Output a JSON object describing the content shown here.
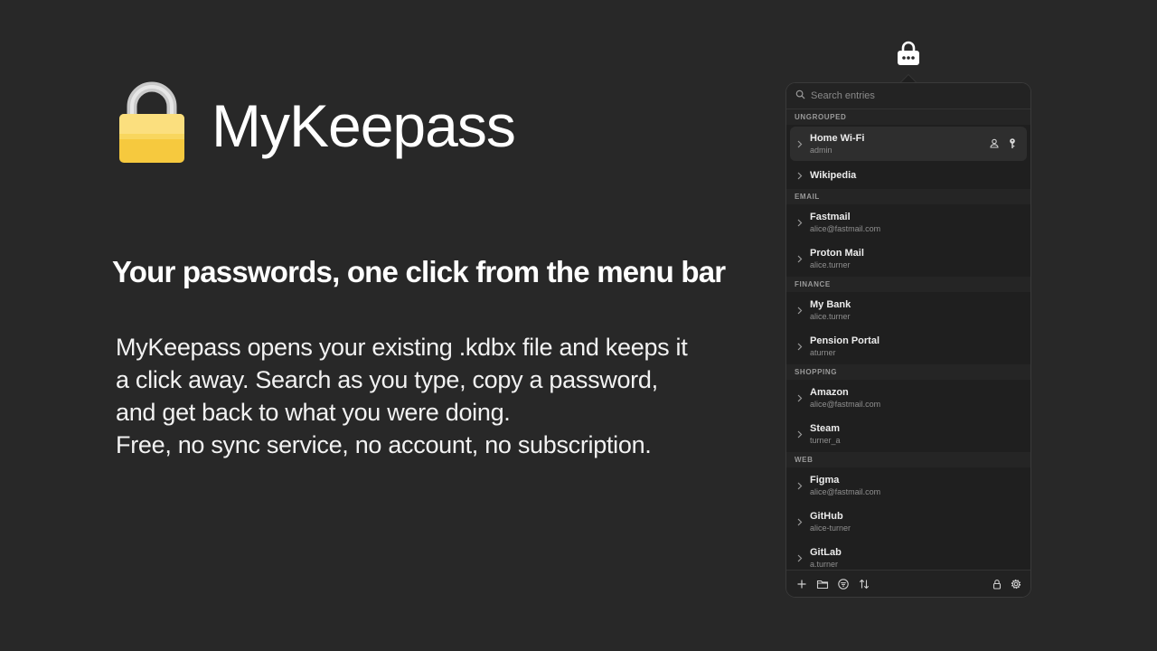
{
  "app": {
    "name": "MyKeepass",
    "tagline": "Your passwords, one click from the menu bar",
    "description_lines": [
      "MyKeepass opens your existing .kdbx file and keeps it",
      "a click away. Search as you type, copy a password,",
      "and get back to what you were doing.",
      "Free, no sync service, no account, no subscription."
    ]
  },
  "menubar": {
    "icon": "lock-icon"
  },
  "popover": {
    "search": {
      "placeholder": "Search entries",
      "value": ""
    },
    "groups": [
      {
        "name": "UNGROUPED",
        "entries": [
          {
            "title": "Home Wi-Fi",
            "username": "admin",
            "selected": true
          },
          {
            "title": "Wikipedia",
            "username": ""
          }
        ]
      },
      {
        "name": "EMAIL",
        "entries": [
          {
            "title": "Fastmail",
            "username": "alice@fastmail.com"
          },
          {
            "title": "Proton Mail",
            "username": "alice.turner"
          }
        ]
      },
      {
        "name": "FINANCE",
        "entries": [
          {
            "title": "My Bank",
            "username": "alice.turner"
          },
          {
            "title": "Pension Portal",
            "username": "aturner"
          }
        ]
      },
      {
        "name": "SHOPPING",
        "entries": [
          {
            "title": "Amazon",
            "username": "alice@fastmail.com"
          },
          {
            "title": "Steam",
            "username": "turner_a"
          }
        ]
      },
      {
        "name": "WEB",
        "entries": [
          {
            "title": "Figma",
            "username": "alice@fastmail.com"
          },
          {
            "title": "GitHub",
            "username": "alice-turner"
          },
          {
            "title": "GitLab",
            "username": "a.turner"
          }
        ]
      }
    ],
    "footer": {
      "left_icons": [
        "plus-icon",
        "folder-icon",
        "filter-icon",
        "sort-icon"
      ],
      "right_icons": [
        "lock-icon",
        "gear-icon"
      ]
    }
  },
  "colors": {
    "background": "#282828",
    "popover_bg": "#1f1f1f",
    "lock_body": "#f9d04a",
    "lock_shackle": "#c8c8c8"
  }
}
